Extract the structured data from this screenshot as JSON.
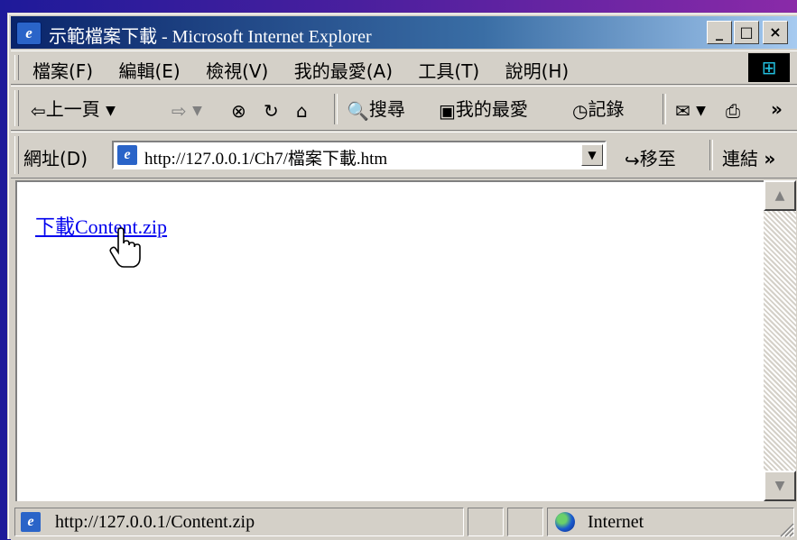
{
  "window": {
    "title": "示範檔案下載 - Microsoft Internet Explorer",
    "app_icon_glyph": "e",
    "controls": {
      "minimize": "_",
      "maximize": "□",
      "close": "×"
    }
  },
  "menubar": {
    "items": [
      "檔案(F)",
      "編輯(E)",
      "檢視(V)",
      "我的最愛(A)",
      "工具(T)",
      "說明(H)"
    ]
  },
  "toolbar": {
    "back_label": "上一頁",
    "search_label": "搜尋",
    "favorites_label": "我的最愛",
    "history_label": "記錄",
    "more": "»"
  },
  "address": {
    "label": "網址(D)",
    "url": "http://127.0.0.1/Ch7/檔案下載.htm",
    "go_label": "移至",
    "links_label": "連結",
    "links_more": "»"
  },
  "content": {
    "link_text": "下載Content.zip"
  },
  "statusbar": {
    "text": "http://127.0.0.1/Content.zip",
    "zone": "Internet"
  },
  "colors": {
    "desktop_left": "#1e1a9a",
    "desktop_right": "#8a2aa8",
    "title_start": "#0a246a",
    "title_end": "#a6caf0",
    "chrome": "#d4d0c8",
    "link": "#0000ee"
  }
}
